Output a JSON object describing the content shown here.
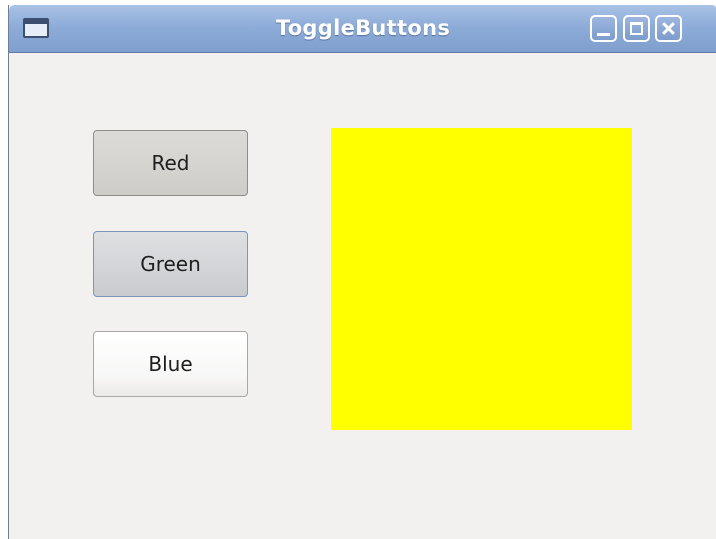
{
  "window": {
    "title": "ToggleButtons"
  },
  "buttons": [
    {
      "label": "Red",
      "state": "pressed"
    },
    {
      "label": "Green",
      "state": "pressed-hover"
    },
    {
      "label": "Blue",
      "state": "released"
    }
  ],
  "swatch": {
    "color": "#ffff00"
  },
  "colors": {
    "titlebar": "#8eacd8",
    "window_bg": "#f2f1f0"
  },
  "icons": [
    "app-window-icon",
    "minimize-icon",
    "maximize-icon",
    "close-icon"
  ]
}
